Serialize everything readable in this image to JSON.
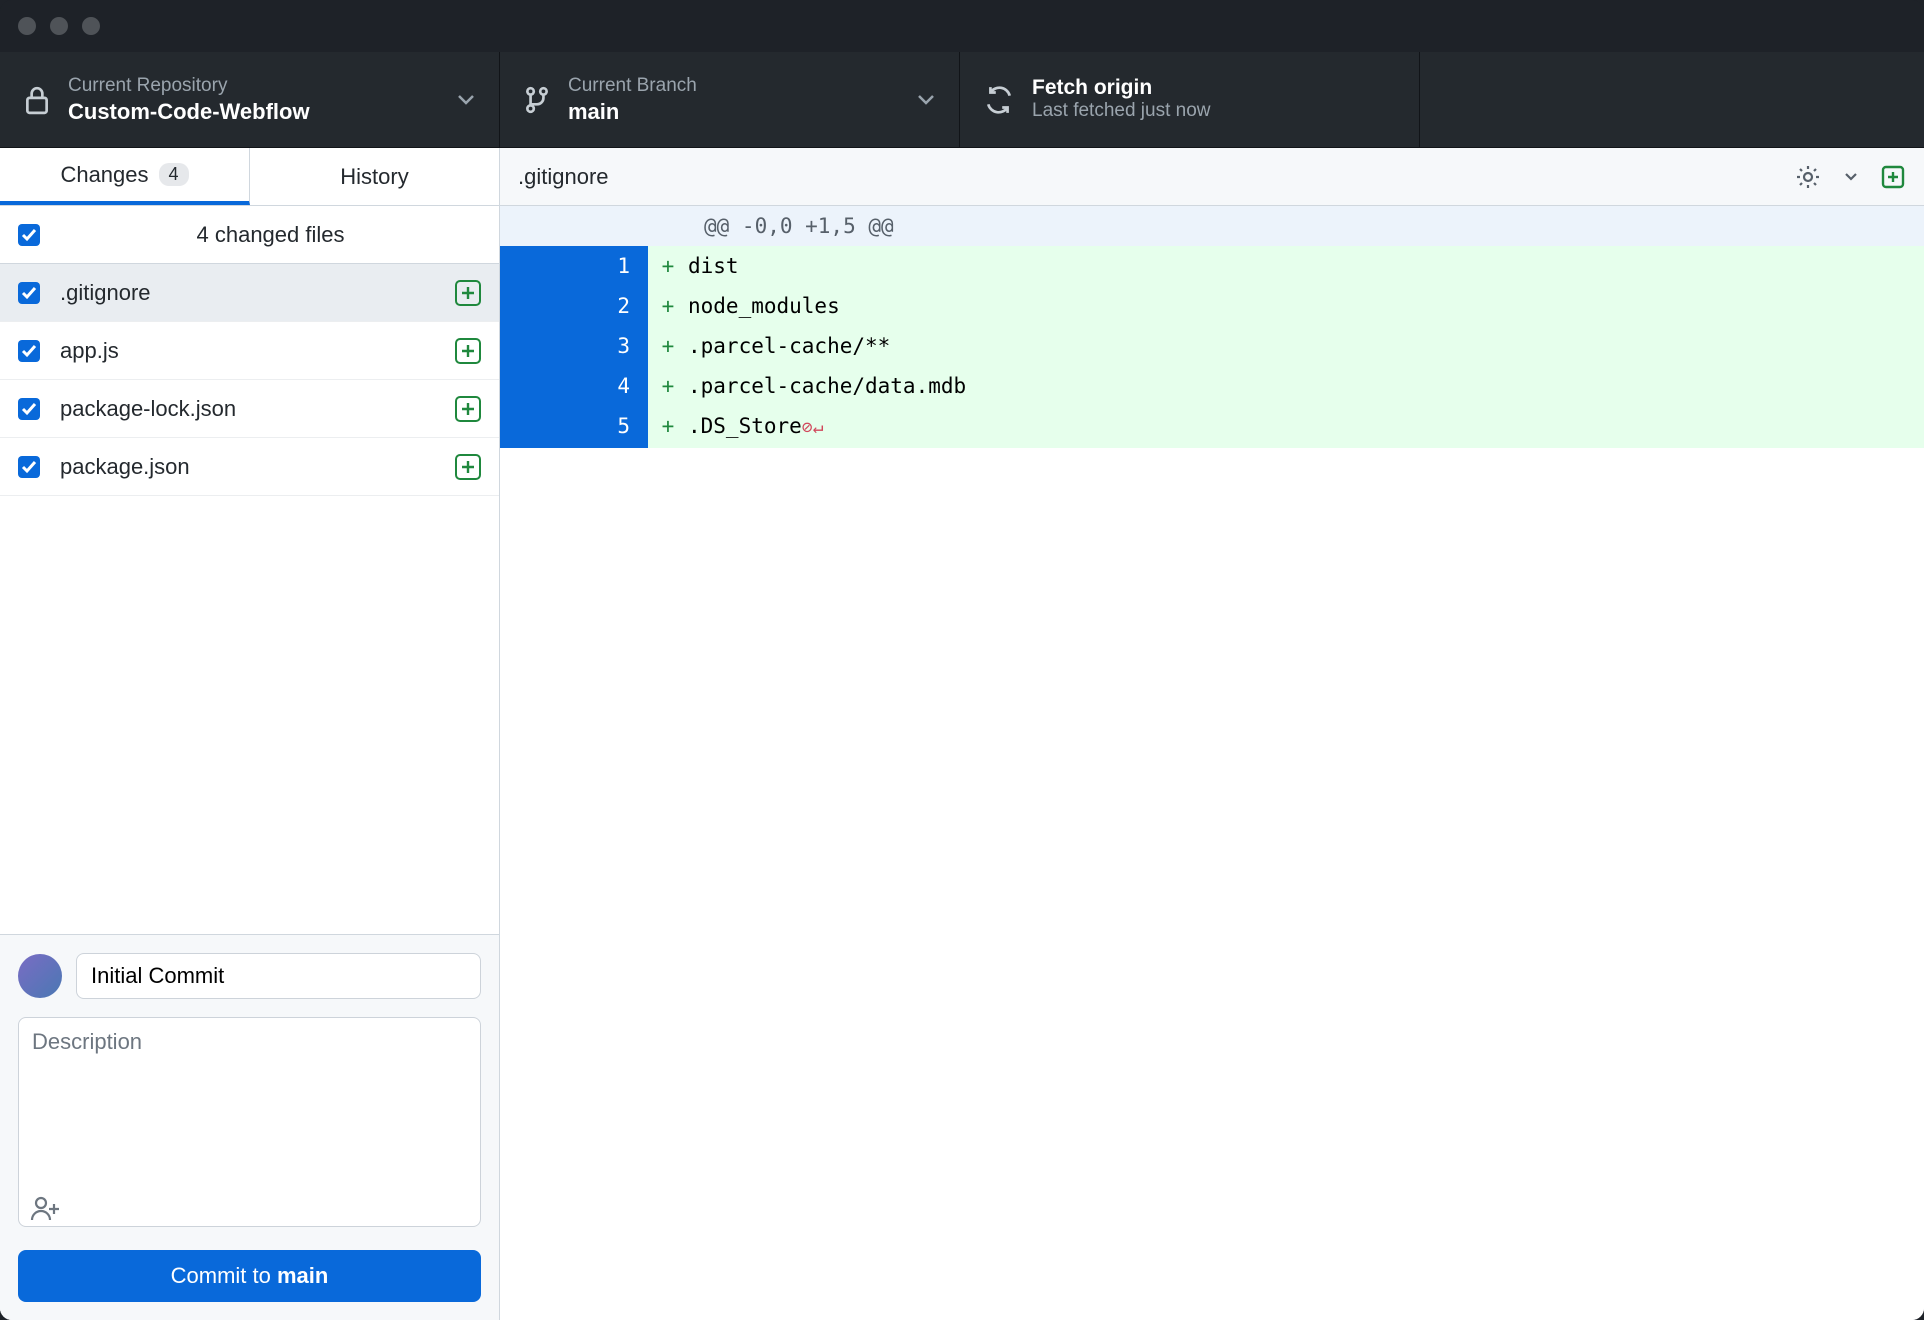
{
  "toolbar": {
    "repo": {
      "label": "Current Repository",
      "value": "Custom-Code-Webflow"
    },
    "branch": {
      "label": "Current Branch",
      "value": "main"
    },
    "fetch": {
      "label": "Fetch origin",
      "sub": "Last fetched just now"
    }
  },
  "tabs": {
    "changes": "Changes",
    "changes_count": "4",
    "history": "History"
  },
  "summary": "4 changed files",
  "files": [
    {
      "name": ".gitignore",
      "selected": true
    },
    {
      "name": "app.js",
      "selected": false
    },
    {
      "name": "package-lock.json",
      "selected": false
    },
    {
      "name": "package.json",
      "selected": false
    }
  ],
  "commit": {
    "summary_value": "Initial Commit",
    "description_placeholder": "Description",
    "button_prefix": "Commit to ",
    "button_branch": "main"
  },
  "diff": {
    "filename": ".gitignore",
    "hunk": "@@ -0,0 +1,5 @@",
    "lines": [
      {
        "n": "1",
        "text": "dist"
      },
      {
        "n": "2",
        "text": "node_modules"
      },
      {
        "n": "3",
        "text": ".parcel-cache/**"
      },
      {
        "n": "4",
        "text": ".parcel-cache/data.mdb"
      },
      {
        "n": "5",
        "text": ".DS_Store",
        "eol": true
      }
    ]
  }
}
